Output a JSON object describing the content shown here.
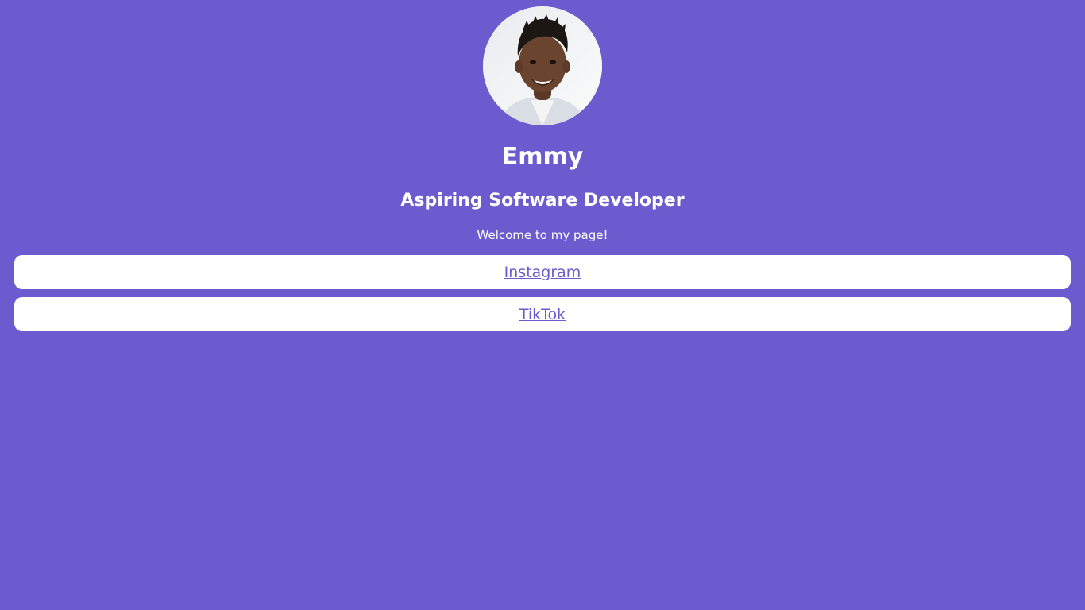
{
  "profile": {
    "name": "Emmy",
    "tagline": "Aspiring Software Developer",
    "welcome": "Welcome to my page!"
  },
  "links": [
    {
      "label": "Instagram"
    },
    {
      "label": "TikTok"
    }
  ],
  "colors": {
    "background": "#6b5bce",
    "card": "#ffffff",
    "link_text": "#6b5bce"
  }
}
